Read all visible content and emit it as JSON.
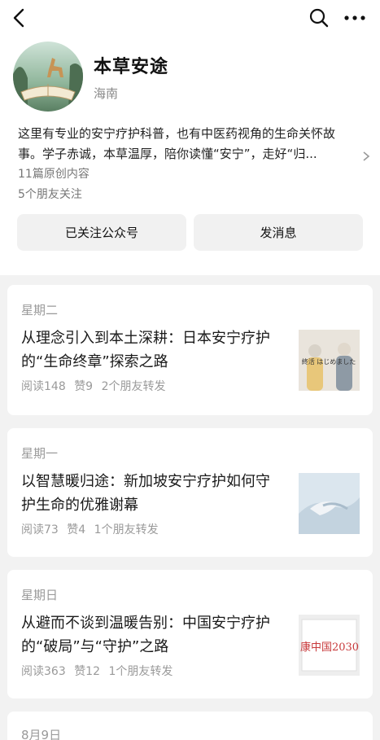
{
  "nav": {
    "back_icon": "back-chevron-icon",
    "search_icon": "search-icon",
    "more_icon": "more-dots-icon"
  },
  "profile": {
    "avatar_text": "本草 安途",
    "name": "本草安途",
    "region": "海南",
    "description_line1": "这里有专业的安宁疗护科普，也有中医药视角的生命关怀故",
    "description_line2": "事。学子赤诚，本草温厚，陪你读懂“安宁”，走好“归...",
    "original_count": "11篇原创内容",
    "friends_following": "5个朋友关注"
  },
  "buttons": {
    "followed": "已关注公众号",
    "message": "发消息"
  },
  "articles": [
    {
      "day": "星期二",
      "title": "从理念引入到本土深耕：日本安宁疗护的“生命终章”探索之路",
      "reads": "阅读148",
      "likes": "赞9",
      "shares": "2个朋友转发",
      "thumb_text": "終活 はじめました"
    },
    {
      "day": "星期一",
      "title": "以智慧暖归途：新加坡安宁疗护如何守护生命的优雅谢幕",
      "reads": "阅读73",
      "likes": "赞4",
      "shares": "1个朋友转发",
      "thumb_text": ""
    },
    {
      "day": "星期日",
      "title": "从避而不谈到温暖告别：中国安宁疗护的“破局”与“守护”之路",
      "reads": "阅读363",
      "likes": "赞12",
      "shares": "1个朋友转发",
      "thumb_text": "康中国2030"
    },
    {
      "day": "8月9日"
    }
  ],
  "colors": {
    "feed_background": "#f2f2f2",
    "button_background": "#f1f1f1",
    "muted_text": "#9a9a9a"
  }
}
